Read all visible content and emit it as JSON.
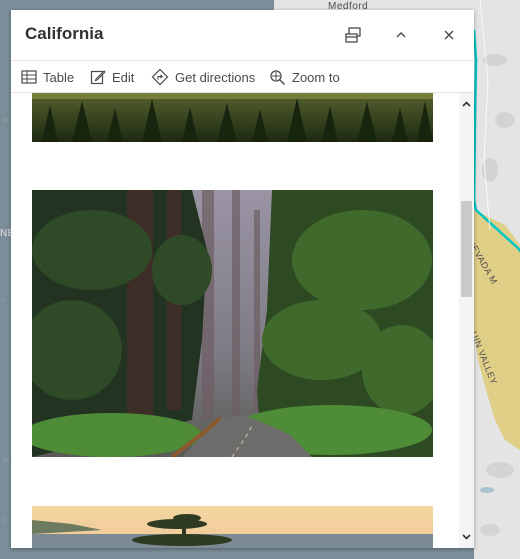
{
  "map": {
    "label_medford": "Medford",
    "label_ne": "NE",
    "label_sierra": "A NEVADA M",
    "label_valley": "UIN VALLEY"
  },
  "popup": {
    "title": "California",
    "dock_label": "Dock",
    "collapse_label": "Collapse",
    "close_label": "Close",
    "actions": [
      {
        "label": "Table",
        "icon": "table-icon"
      },
      {
        "label": "Edit",
        "icon": "edit-icon"
      },
      {
        "label": "Get directions",
        "icon": "directions-icon"
      },
      {
        "label": "Zoom to",
        "icon": "zoom-to-icon"
      }
    ],
    "images": [
      {
        "alt": "Forest treetops"
      },
      {
        "alt": "Redwood forest road"
      },
      {
        "alt": "Coastal sunset"
      }
    ]
  },
  "colors": {
    "accent": "#00c6c6",
    "map_land": "#e8e8e8",
    "valley": "#e0cf86"
  }
}
